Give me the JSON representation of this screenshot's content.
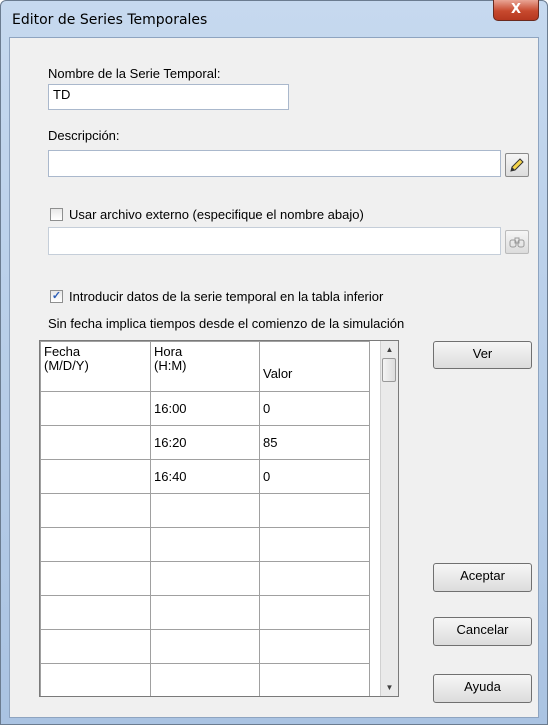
{
  "window": {
    "title": "Editor de Series Temporales",
    "close_glyph": "X"
  },
  "name_field": {
    "label": "Nombre de la Serie Temporal:",
    "value": "TD"
  },
  "description_field": {
    "label": "Descripción:",
    "value": "",
    "edit_icon": "pencil-edit-icon"
  },
  "external_file": {
    "checkbox_label": "Usar archivo externo (especifique el nombre abajo)",
    "checked": false,
    "path_value": "",
    "browse_icon": "browse-binoculars-icon"
  },
  "table_entry": {
    "checkbox_label": "Introducir datos de la serie temporal en la tabla inferior",
    "checked": true,
    "note": "Sin fecha implica tiempos desde el comienzo de la simulación"
  },
  "table": {
    "columns": [
      "Fecha\n(M/D/Y)",
      "Hora\n(H:M)",
      "Valor"
    ],
    "rows": [
      [
        "",
        "16:00",
        "0"
      ],
      [
        "",
        "16:20",
        "85"
      ],
      [
        "",
        "16:40",
        "0"
      ],
      [
        "",
        "",
        ""
      ],
      [
        "",
        "",
        ""
      ],
      [
        "",
        "",
        ""
      ],
      [
        "",
        "",
        ""
      ],
      [
        "",
        "",
        ""
      ],
      [
        "",
        "",
        ""
      ]
    ]
  },
  "buttons": {
    "view": "Ver",
    "accept": "Aceptar",
    "cancel": "Cancelar",
    "help": "Ayuda"
  },
  "scrollbar_glyphs": {
    "up": "▲",
    "down": "▼"
  }
}
